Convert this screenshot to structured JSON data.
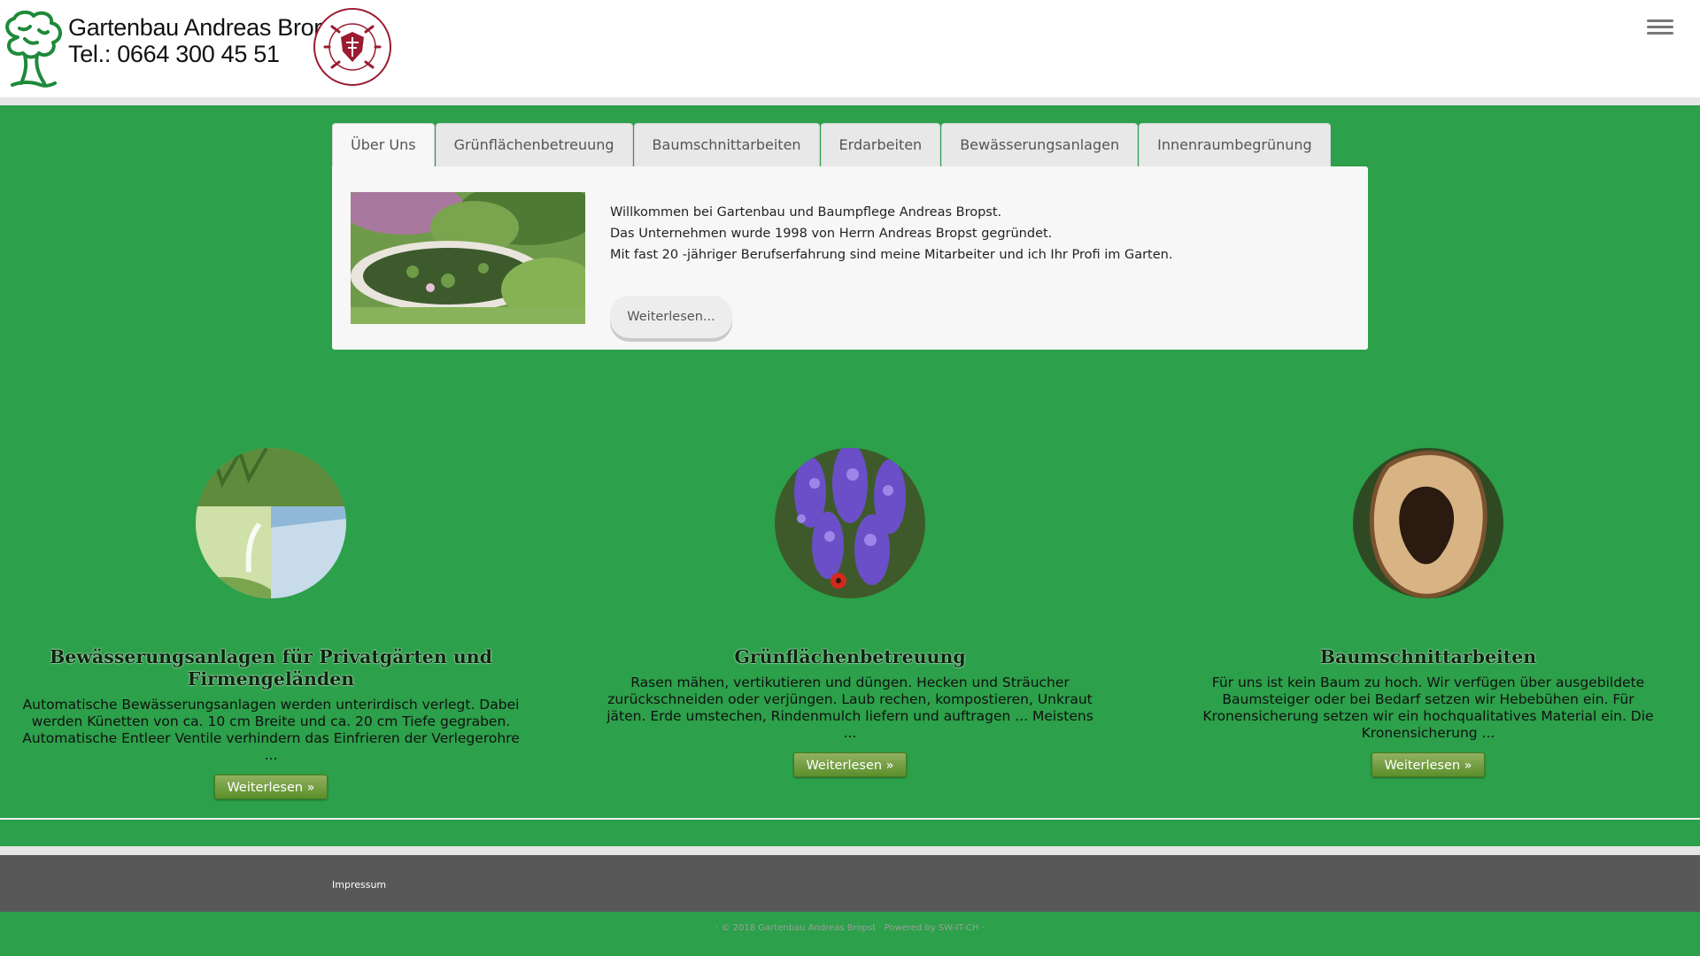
{
  "header": {
    "logo_line1": "Gartenbau Andreas Bropst",
    "logo_line2": "Tel.: 0664 300 45 51",
    "logo_icons": [
      "tree-icon",
      "meister-betrieb-seal-icon"
    ],
    "menu_icon": "hamburger-menu-icon"
  },
  "tabs": [
    {
      "label": "Über Uns",
      "active": true
    },
    {
      "label": "Grünflächenbetreuung",
      "active": false
    },
    {
      "label": "Baumschnittarbeiten",
      "active": false
    },
    {
      "label": "Erdarbeiten",
      "active": false
    },
    {
      "label": "Bewässerungsanlagen",
      "active": false
    },
    {
      "label": "Innenraumbegrünung",
      "active": false
    }
  ],
  "panel": {
    "lines": [
      "Willkommen bei Gartenbau und Baumpflege Andreas Bropst.",
      "Das Unternehmen wurde 1998 von Herrn Andreas Bropst gegründet.",
      "Mit fast 20 -jähriger Berufserfahrung sind meine Mitarbeiter und ich Ihr Profi im Garten."
    ],
    "button_label": "Weiterlesen..."
  },
  "features": [
    {
      "title": "Bewässerungsanlagen für Privatgärten und Firmengeländen",
      "description": "Automatische Bewässerungsanlagen werden unterirdisch verlegt. Dabei werden Künetten von ca. 10 cm Breite und ca. 20 cm Tiefe gegraben. Automatische Entleer Ventile verhindern das Einfrieren der Verlegerohre ...",
      "button_label": "Weiterlesen »"
    },
    {
      "title": "Grünflächenbetreuung",
      "description": "Rasen mähen, vertikutieren und düngen. Hecken und Sträucher zurückschneiden oder verjüngen. Laub rechen, kompostieren, Unkraut jäten. Erde umstechen, Rindenmulch liefern und auftragen ... Meistens ...",
      "button_label": "Weiterlesen »"
    },
    {
      "title": "Baumschnittarbeiten",
      "description": "Für uns ist kein Baum zu hoch. Wir verfügen über ausgebildete Baumsteiger oder bei Bedarf setzen wir Hebebühen ein. Für Kronensicherung setzen wir ein hochqualitatives Material ein. Die Kronensicherung ...",
      "button_label": "Weiterlesen »"
    }
  ],
  "footer": {
    "impressum": "Impressum",
    "copyright": "· © 2018 Gartenbau Andreas Bropst · Powered by SW-IT-CH ·"
  },
  "colors": {
    "page_green": "#2ca04a",
    "footer_gray": "#585858",
    "button_green": "#6e9a3a",
    "logo_tree_green": "#1e8a3a",
    "seal_red": "#9b1b30"
  }
}
